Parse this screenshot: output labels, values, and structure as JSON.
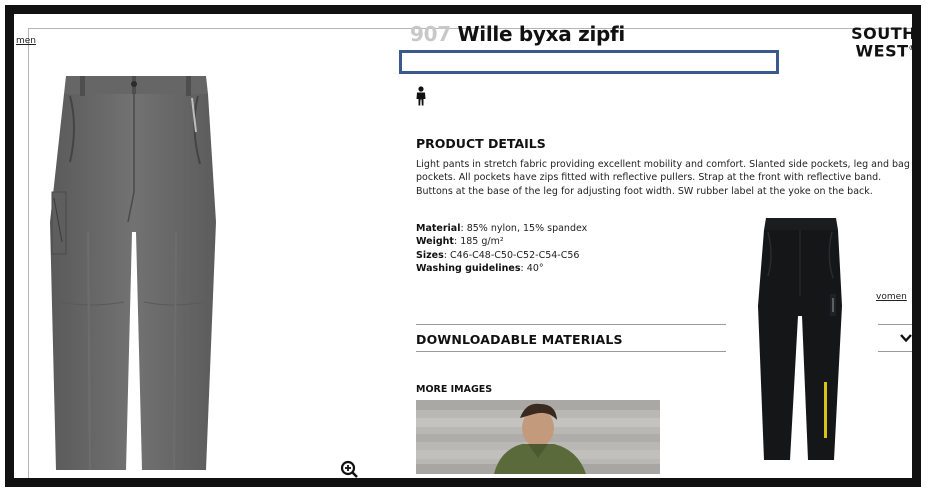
{
  "links": {
    "left_truncated": "men",
    "right_truncated": "vomen"
  },
  "product": {
    "number": "907",
    "name": "Wille byxa zipfi",
    "brand_line1": "SOUTH",
    "brand_line2": "WEST",
    "brand_mark": "®"
  },
  "details": {
    "heading": "PRODUCT DETAILS",
    "description": "Light pants in stretch fabric providing excellent mobility and comfort. Slanted side pockets, leg and bag pockets. All pockets have zips fitted with reflective pullers. Strap at the front with reflective band. Buttons at the base of the leg for adjusting foot width. SW rubber label at the yoke on the back.",
    "specs": [
      {
        "label": "Material",
        "value": "85% nylon, 15% spandex"
      },
      {
        "label": "Weight",
        "value": "185 g/m²"
      },
      {
        "label": "Sizes",
        "value": "C46-C48-C50-C52-C54-C56"
      },
      {
        "label": "Washing guidelines",
        "value": "40°"
      }
    ]
  },
  "downloads": {
    "heading": "DOWNLOADABLE MATERIALS"
  },
  "more_images": {
    "heading": "MORE IMAGES"
  },
  "icons": {
    "zoom": "zoom-in-icon",
    "person": "person-icon",
    "chevron": "chevron-down-icon"
  },
  "colors": {
    "highlight_border": "#3b5a8c",
    "pants_grey": "#6b6b6b",
    "pants_black": "#151617",
    "accent_yellow": "#d9c21a",
    "product_number": "#c8c8c8"
  }
}
